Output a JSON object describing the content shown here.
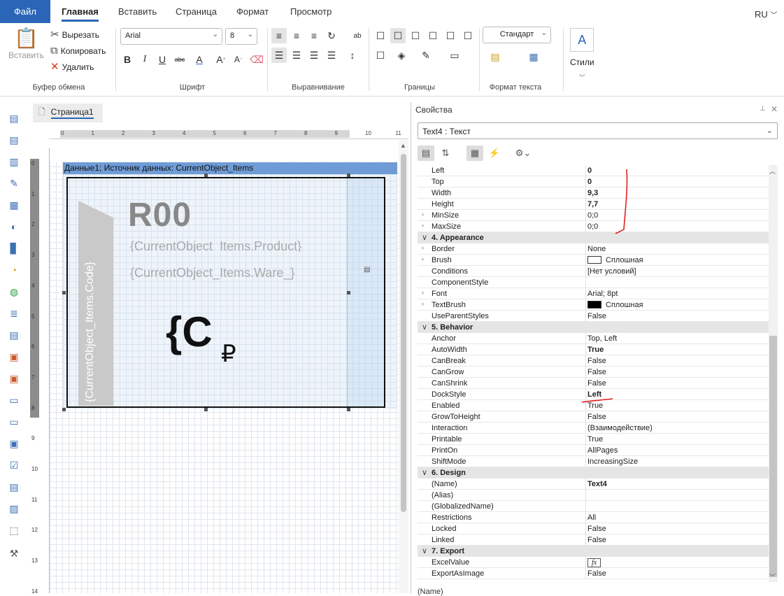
{
  "menu": {
    "file": "Файл",
    "tabs": [
      "Главная",
      "Вставить",
      "Страница",
      "Формат",
      "Просмотр"
    ],
    "lang": "RU"
  },
  "ribbon": {
    "paste": "Вставить",
    "cut": "Вырезать",
    "copy": "Копировать",
    "delete": "Удалить",
    "clipboard_label": "Буфер обмена",
    "font_name": "Arial",
    "font_size": "8",
    "font_label": "Шрифт",
    "align_label": "Выравнивание",
    "borders_label": "Границы",
    "style_combo": "Стандарт",
    "textformat_label": "Формат текста",
    "styles": "Стили"
  },
  "page_tab": "Страница1",
  "h_ruler": [
    "0",
    "1",
    "2",
    "3",
    "4",
    "5",
    "6",
    "7",
    "8",
    "9",
    "10",
    "11"
  ],
  "v_ruler": [
    "0",
    "1",
    "2",
    "3",
    "4",
    "5",
    "6",
    "7",
    "8",
    "9",
    "10",
    "11",
    "12",
    "13",
    "14"
  ],
  "design": {
    "band_header": "Данные1; Источник данных: CurrentObject_Items",
    "code_text": "{CurrentObject_Items.Code}",
    "r00": "R00",
    "product_text": "{CurrentObject_Items.Product}",
    "ware_text": "{CurrentObject_Items.Ware_}",
    "price_glyph": "{C",
    "ruble": "₽"
  },
  "props": {
    "title": "Свойства",
    "object": "Text4 : Текст",
    "rows": [
      {
        "name": "Left",
        "value": "0",
        "bold": true
      },
      {
        "name": "Top",
        "value": "0",
        "bold": true
      },
      {
        "name": "Width",
        "value": "9,3",
        "bold": true
      },
      {
        "name": "Height",
        "value": "7,7",
        "bold": true
      },
      {
        "name": "MinSize",
        "value": "0;0",
        "exp": "›"
      },
      {
        "name": "MaxSize",
        "value": "0;0",
        "exp": "›"
      },
      {
        "name": "4. Appearance",
        "cat": true
      },
      {
        "name": "Border",
        "value": "None",
        "exp": "›"
      },
      {
        "name": "Brush",
        "value": "Сплошная",
        "exp": "›",
        "swatch": "#ffffff"
      },
      {
        "name": "Conditions",
        "value": "[Нет условий]"
      },
      {
        "name": "ComponentStyle",
        "value": ""
      },
      {
        "name": "Font",
        "value": "Arial; 8pt",
        "exp": "›"
      },
      {
        "name": "TextBrush",
        "value": "Сплошная",
        "exp": "›",
        "swatch": "#000000"
      },
      {
        "name": "UseParentStyles",
        "value": "False"
      },
      {
        "name": "5. Behavior",
        "cat": true
      },
      {
        "name": "Anchor",
        "value": "Top, Left"
      },
      {
        "name": "AutoWidth",
        "value": "True",
        "bold": true
      },
      {
        "name": "CanBreak",
        "value": "False"
      },
      {
        "name": "CanGrow",
        "value": "False"
      },
      {
        "name": "CanShrink",
        "value": "False"
      },
      {
        "name": "DockStyle",
        "value": "Left",
        "bold": true
      },
      {
        "name": "Enabled",
        "value": "True"
      },
      {
        "name": "GrowToHeight",
        "value": "False"
      },
      {
        "name": "Interaction",
        "value": "(Взаимодействие)"
      },
      {
        "name": "Printable",
        "value": "True"
      },
      {
        "name": "PrintOn",
        "value": "AllPages"
      },
      {
        "name": "ShiftMode",
        "value": "IncreasingSize"
      },
      {
        "name": "6. Design",
        "cat": true
      },
      {
        "name": "(Name)",
        "value": "Text4",
        "bold": true
      },
      {
        "name": "(Alias)",
        "value": ""
      },
      {
        "name": "(GlobalizedName)",
        "value": ""
      },
      {
        "name": "Restrictions",
        "value": "All"
      },
      {
        "name": "Locked",
        "value": "False"
      },
      {
        "name": "Linked",
        "value": "False"
      },
      {
        "name": "7. Export",
        "cat": true
      },
      {
        "name": "ExcelValue",
        "value": "fx",
        "fx": true
      },
      {
        "name": "ExportAsImage",
        "value": "False"
      }
    ],
    "footer": "(Name)"
  },
  "colors": {
    "accent": "#2b65b7",
    "band_header": "#6f9cd6",
    "annotation": "#e0201e"
  }
}
